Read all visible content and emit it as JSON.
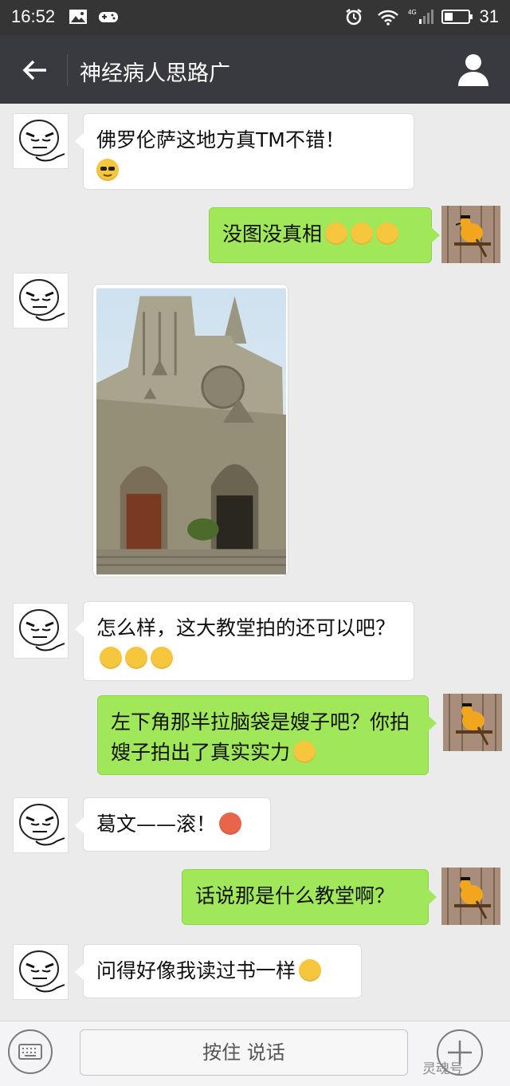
{
  "status_bar": {
    "time": "16:52",
    "battery": "31"
  },
  "header": {
    "title": "神经病人思路广"
  },
  "messages": [
    {
      "side": "in",
      "text": "佛罗伦萨这地方真TM不错！",
      "emoji": "cool"
    },
    {
      "side": "out",
      "text": "没图没真相",
      "emoji": "sleepy x3"
    },
    {
      "side": "in",
      "type": "image",
      "alt": "cathedral photo"
    },
    {
      "side": "in",
      "text": "怎么样，这大教堂拍的还可以吧？",
      "emoji": "grin x3"
    },
    {
      "side": "out",
      "text": "左下角那半拉脑袋是嫂子吧？你拍嫂子拍出了真实实力",
      "emoji": "thumbs-up"
    },
    {
      "side": "in",
      "text": "葛文——滚！",
      "emoji": "angry"
    },
    {
      "side": "out",
      "text": "话说那是什么教堂啊？"
    },
    {
      "side": "in",
      "text": "问得好像我读过书一样",
      "emoji": "confused"
    }
  ],
  "input_bar": {
    "hold_to_talk": "按住 说话"
  },
  "watermark": "灵魂号",
  "colors": {
    "statusbar": "#353535",
    "titlebar": "#393a3f",
    "chat_bg": "#ebebeb",
    "bubble_out": "#a0e75a",
    "bubble_in": "#ffffff"
  }
}
